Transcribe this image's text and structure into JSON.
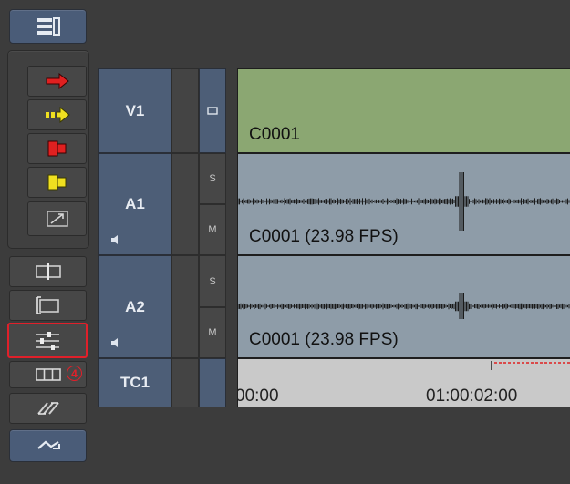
{
  "tool_palette": {
    "top_button_icon": "timeline-menu-icon",
    "group_tools": [
      {
        "name": "lift-overwrite-red-arrow",
        "icon": "red-arrow-icon",
        "color": "#e02020"
      },
      {
        "name": "lift-overwrite-yellow-arrow",
        "icon": "yellow-arrow-icon",
        "color": "#f0e020"
      },
      {
        "name": "extract-splice-red",
        "icon": "red-splice-icon",
        "color": "#e02020"
      },
      {
        "name": "extract-splice-yellow",
        "icon": "yellow-splice-icon",
        "color": "#f0e020"
      },
      {
        "name": "segment-mode",
        "icon": "segment-icon"
      }
    ],
    "lower_tools": [
      {
        "name": "split-clip",
        "icon": "split-clip-icon"
      },
      {
        "name": "trim-clip",
        "icon": "trim-clip-icon"
      },
      {
        "name": "audio-mixer",
        "icon": "sliders-icon",
        "highlighted": true
      },
      {
        "name": "clip-frames",
        "icon": "film-frames-icon",
        "badge": "4"
      },
      {
        "name": "link-tool",
        "icon": "chain-icon"
      }
    ],
    "bottom_button_icon": "expand-arrows-icon",
    "highlight_color": "#e0202a"
  },
  "tracks": [
    {
      "name": "V1",
      "type": "video",
      "col3_icon": "monitor-icon",
      "clip_label": "C0001",
      "clip_color": "#8ba772"
    },
    {
      "name": "A1",
      "type": "audio",
      "solo": "S",
      "mute": "M",
      "speaker_icon": "speaker-icon",
      "clip_label": "C0001 (23.98 FPS)",
      "clip_color": "#8e9ca8"
    },
    {
      "name": "A2",
      "type": "audio",
      "solo": "S",
      "mute": "M",
      "speaker_icon": "speaker-icon",
      "clip_label": "C0001 (23.98 FPS)",
      "clip_color": "#8e9ca8"
    },
    {
      "name": "TC1",
      "type": "timecode",
      "timecodes": [
        "00:00",
        "01:00:02:00"
      ]
    }
  ],
  "colors": {
    "background": "#3c3c3c",
    "track_header_blue": "#4d5e77",
    "video_clip": "#8ba772",
    "audio_clip": "#8e9ca8",
    "timecode_ruler": "#c9c9c9",
    "playhead_red": "#e02020"
  }
}
